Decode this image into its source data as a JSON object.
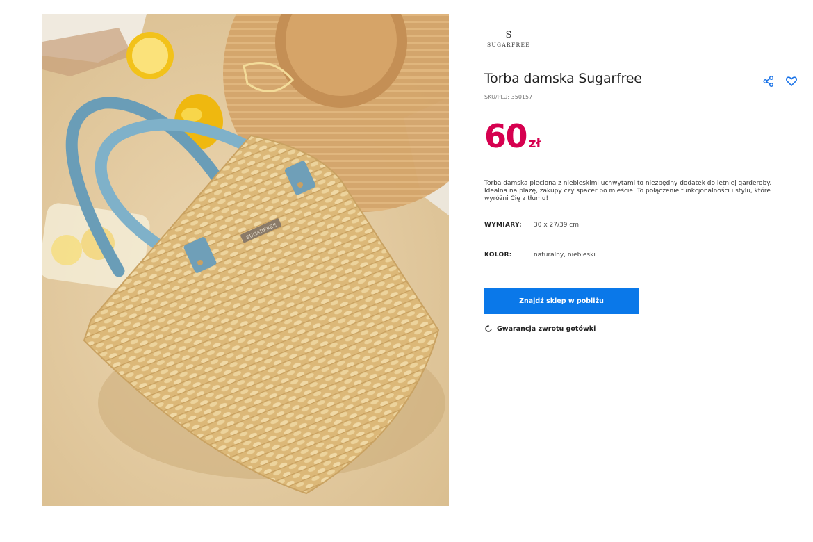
{
  "brand": {
    "mark": "S",
    "name": "SUGARFREE"
  },
  "product": {
    "title": "Torba damska Sugarfree",
    "sku": "SKU/PLU: 350157",
    "price_value": "60",
    "price_currency": "zł",
    "description": "Torba damska pleciona z niebieskimi uchwytami to niezbędny dodatek do letniej garderoby. Idealna na plażę, zakupy czy spacer po mieście. To połączenie funkcjonalności i stylu, które wyróżni Cię z tłumu!",
    "attributes": {
      "dimensions": {
        "label": "WYMIARY:",
        "value": "30 x 27/39 cm"
      },
      "color": {
        "label": "KOLOR:",
        "value": "naturalny, niebieski"
      }
    }
  },
  "actions": {
    "find_store_label": "Znajdź sklep w pobliżu",
    "guarantee_label": "Gwarancja zwrotu gotówki",
    "share_icon": "share-icon",
    "favorite_icon": "heart-icon"
  },
  "image": {
    "bag_label": "SUGARFREE"
  },
  "colors": {
    "accent": "#d6004f",
    "cta": "#0a78e9",
    "icon": "#1a73e8"
  }
}
